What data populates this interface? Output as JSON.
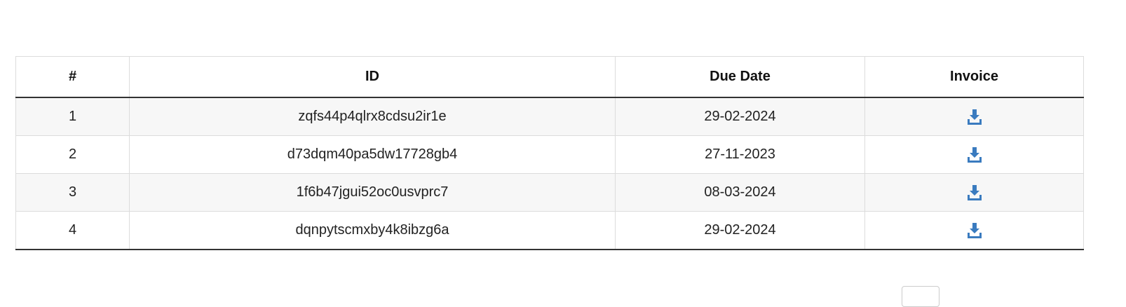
{
  "table": {
    "headers": [
      "#",
      "ID",
      "Due Date",
      "Invoice"
    ],
    "rows": [
      {
        "num": "1",
        "id": "zqfs44p4qlrx8cdsu2ir1e",
        "due_date": "29-02-2024",
        "invoice_icon": "download-icon"
      },
      {
        "num": "2",
        "id": "d73dqm40pa5dw17728gb4",
        "due_date": "27-11-2023",
        "invoice_icon": "download-icon"
      },
      {
        "num": "3",
        "id": "1f6b47jgui52oc0usvprc7",
        "due_date": "08-03-2024",
        "invoice_icon": "download-icon"
      },
      {
        "num": "4",
        "id": "dqnpytscmxby4k8ibzg6a",
        "due_date": "29-02-2024",
        "invoice_icon": "download-icon"
      }
    ]
  },
  "colors": {
    "icon": "#3a7bbf",
    "stripe": "#f7f7f7",
    "header_rule": "#333333"
  }
}
